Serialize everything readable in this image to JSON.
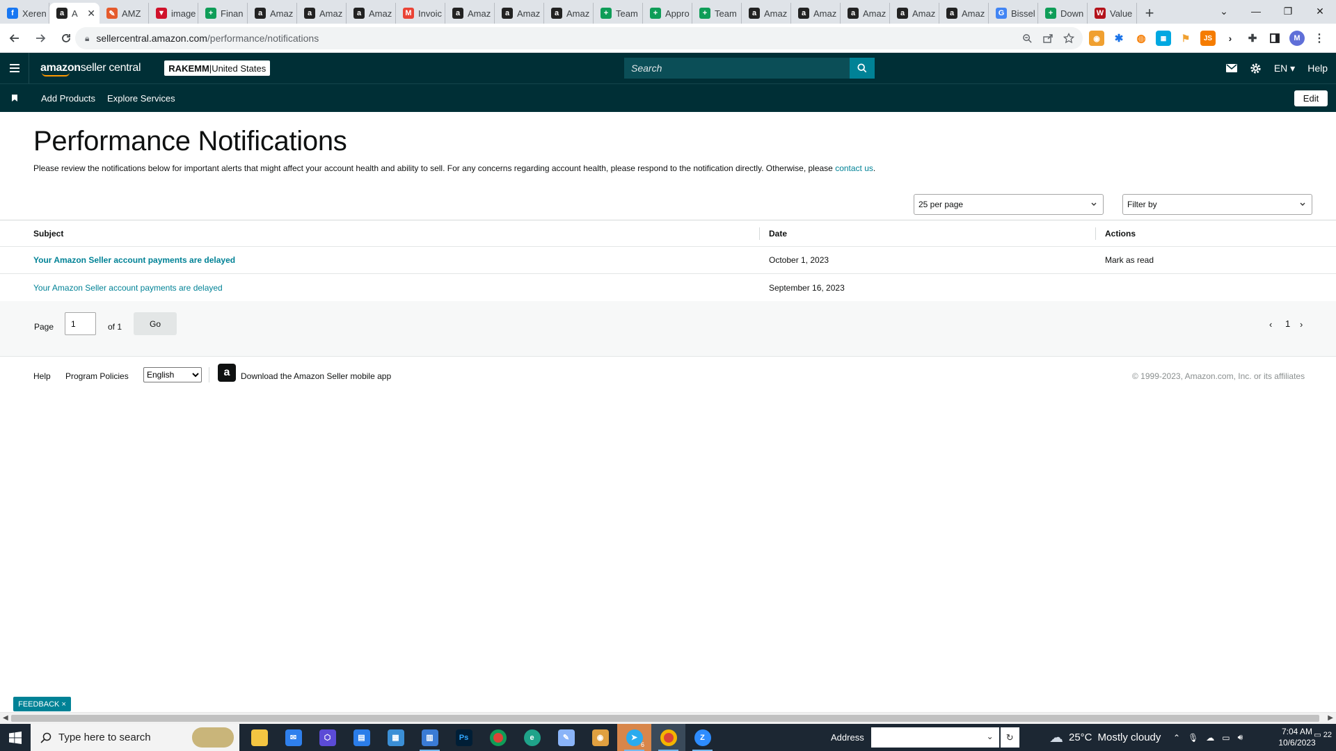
{
  "browser": {
    "tabs": [
      {
        "title": "Xeren",
        "fav": "f",
        "color": "#1877f2"
      },
      {
        "title": "A",
        "fav": "a",
        "color": "#222222",
        "active": true
      },
      {
        "title": "AMZ",
        "fav": "✎",
        "color": "#e55b2d"
      },
      {
        "title": "image",
        "fav": "▼",
        "color": "#d0122b"
      },
      {
        "title": "Finan",
        "fav": "+",
        "color": "#0f9d58"
      },
      {
        "title": "Amaz",
        "fav": "a",
        "color": "#222222"
      },
      {
        "title": "Amaz",
        "fav": "a",
        "color": "#222222"
      },
      {
        "title": "Amaz",
        "fav": "a",
        "color": "#222222"
      },
      {
        "title": "Invoic",
        "fav": "M",
        "color": "#ea4335"
      },
      {
        "title": "Amaz",
        "fav": "a",
        "color": "#222222"
      },
      {
        "title": "Amaz",
        "fav": "a",
        "color": "#222222"
      },
      {
        "title": "Amaz",
        "fav": "a",
        "color": "#222222"
      },
      {
        "title": "Team",
        "fav": "+",
        "color": "#0f9d58"
      },
      {
        "title": "Appro",
        "fav": "+",
        "color": "#0f9d58"
      },
      {
        "title": "Team",
        "fav": "+",
        "color": "#0f9d58"
      },
      {
        "title": "Amaz",
        "fav": "a",
        "color": "#222222"
      },
      {
        "title": "Amaz",
        "fav": "a",
        "color": "#222222"
      },
      {
        "title": "Amaz",
        "fav": "a",
        "color": "#222222"
      },
      {
        "title": "Amaz",
        "fav": "a",
        "color": "#222222"
      },
      {
        "title": "Amaz",
        "fav": "a",
        "color": "#222222"
      },
      {
        "title": "Bissel",
        "fav": "G",
        "color": "#4285f4"
      },
      {
        "title": "Down",
        "fav": "+",
        "color": "#0f9d58"
      },
      {
        "title": "Value",
        "fav": "W",
        "color": "#b3121a"
      }
    ],
    "url_host": "sellercentral.amazon.com",
    "url_path": "/performance/notifications",
    "profile_initial": "M"
  },
  "header": {
    "logo_amazon": "amazon",
    "logo_rest": " seller central",
    "account_name": "RAKEMM",
    "account_sep": " | ",
    "account_region": "United States",
    "search_placeholder": "Search",
    "lang": "EN",
    "help": "Help"
  },
  "subnav": {
    "items": [
      "Add Products",
      "Explore Services"
    ],
    "edit_label": "Edit"
  },
  "page": {
    "title": "Performance Notifications",
    "intro_text": "Please review the notifications below for important alerts that might affect your account health and ability to sell. For any concerns regarding account health, please respond to the notification directly. Otherwise, please ",
    "intro_link": "contact us",
    "intro_end": ".",
    "per_page": "25 per page",
    "filter_placeholder": "Filter by",
    "table": {
      "headers": [
        "Subject",
        "Date",
        "Actions"
      ],
      "rows": [
        {
          "subject": "Your Amazon Seller account payments are delayed",
          "date": "October 1, 2023",
          "action": "Mark as read",
          "unread": true
        },
        {
          "subject": "Your Amazon Seller account payments are delayed",
          "date": "September 16, 2023",
          "action": "",
          "unread": false
        }
      ]
    },
    "pager": {
      "page_label": "Page",
      "page_value": "1",
      "of_label": "of 1",
      "go_label": "Go",
      "current_page": "1"
    }
  },
  "footer": {
    "help": "Help",
    "policies": "Program Policies",
    "language": "English",
    "app_text": "Download the Amazon Seller mobile app",
    "copyright": "© 1999-2023, Amazon.com, Inc. or its affiliates"
  },
  "feedback_label": "FEEDBACK",
  "taskbar": {
    "search_placeholder": "Type here to search",
    "address_label": "Address",
    "temp": "25°C",
    "weather_text": "Mostly cloudy",
    "time": "7:04 AM",
    "date": "10/6/2023",
    "notification_count": "22",
    "badge": "6"
  }
}
